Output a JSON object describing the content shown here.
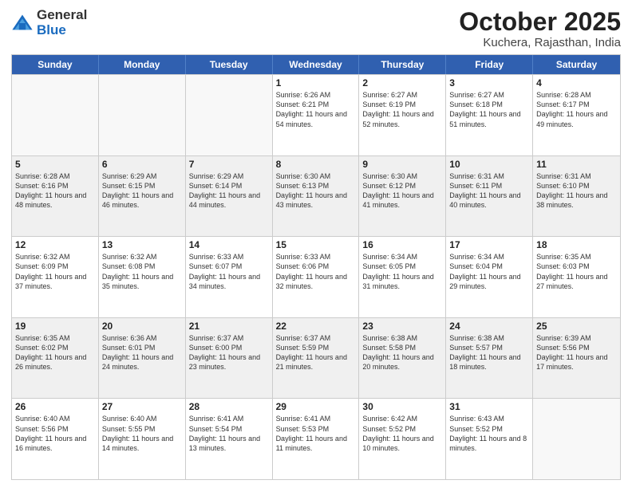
{
  "logo": {
    "general": "General",
    "blue": "Blue"
  },
  "header": {
    "month": "October 2025",
    "location": "Kuchera, Rajasthan, India"
  },
  "days": [
    "Sunday",
    "Monday",
    "Tuesday",
    "Wednesday",
    "Thursday",
    "Friday",
    "Saturday"
  ],
  "rows": [
    [
      {
        "day": "",
        "info": ""
      },
      {
        "day": "",
        "info": ""
      },
      {
        "day": "",
        "info": ""
      },
      {
        "day": "1",
        "info": "Sunrise: 6:26 AM\nSunset: 6:21 PM\nDaylight: 11 hours and 54 minutes."
      },
      {
        "day": "2",
        "info": "Sunrise: 6:27 AM\nSunset: 6:19 PM\nDaylight: 11 hours and 52 minutes."
      },
      {
        "day": "3",
        "info": "Sunrise: 6:27 AM\nSunset: 6:18 PM\nDaylight: 11 hours and 51 minutes."
      },
      {
        "day": "4",
        "info": "Sunrise: 6:28 AM\nSunset: 6:17 PM\nDaylight: 11 hours and 49 minutes."
      }
    ],
    [
      {
        "day": "5",
        "info": "Sunrise: 6:28 AM\nSunset: 6:16 PM\nDaylight: 11 hours and 48 minutes."
      },
      {
        "day": "6",
        "info": "Sunrise: 6:29 AM\nSunset: 6:15 PM\nDaylight: 11 hours and 46 minutes."
      },
      {
        "day": "7",
        "info": "Sunrise: 6:29 AM\nSunset: 6:14 PM\nDaylight: 11 hours and 44 minutes."
      },
      {
        "day": "8",
        "info": "Sunrise: 6:30 AM\nSunset: 6:13 PM\nDaylight: 11 hours and 43 minutes."
      },
      {
        "day": "9",
        "info": "Sunrise: 6:30 AM\nSunset: 6:12 PM\nDaylight: 11 hours and 41 minutes."
      },
      {
        "day": "10",
        "info": "Sunrise: 6:31 AM\nSunset: 6:11 PM\nDaylight: 11 hours and 40 minutes."
      },
      {
        "day": "11",
        "info": "Sunrise: 6:31 AM\nSunset: 6:10 PM\nDaylight: 11 hours and 38 minutes."
      }
    ],
    [
      {
        "day": "12",
        "info": "Sunrise: 6:32 AM\nSunset: 6:09 PM\nDaylight: 11 hours and 37 minutes."
      },
      {
        "day": "13",
        "info": "Sunrise: 6:32 AM\nSunset: 6:08 PM\nDaylight: 11 hours and 35 minutes."
      },
      {
        "day": "14",
        "info": "Sunrise: 6:33 AM\nSunset: 6:07 PM\nDaylight: 11 hours and 34 minutes."
      },
      {
        "day": "15",
        "info": "Sunrise: 6:33 AM\nSunset: 6:06 PM\nDaylight: 11 hours and 32 minutes."
      },
      {
        "day": "16",
        "info": "Sunrise: 6:34 AM\nSunset: 6:05 PM\nDaylight: 11 hours and 31 minutes."
      },
      {
        "day": "17",
        "info": "Sunrise: 6:34 AM\nSunset: 6:04 PM\nDaylight: 11 hours and 29 minutes."
      },
      {
        "day": "18",
        "info": "Sunrise: 6:35 AM\nSunset: 6:03 PM\nDaylight: 11 hours and 27 minutes."
      }
    ],
    [
      {
        "day": "19",
        "info": "Sunrise: 6:35 AM\nSunset: 6:02 PM\nDaylight: 11 hours and 26 minutes."
      },
      {
        "day": "20",
        "info": "Sunrise: 6:36 AM\nSunset: 6:01 PM\nDaylight: 11 hours and 24 minutes."
      },
      {
        "day": "21",
        "info": "Sunrise: 6:37 AM\nSunset: 6:00 PM\nDaylight: 11 hours and 23 minutes."
      },
      {
        "day": "22",
        "info": "Sunrise: 6:37 AM\nSunset: 5:59 PM\nDaylight: 11 hours and 21 minutes."
      },
      {
        "day": "23",
        "info": "Sunrise: 6:38 AM\nSunset: 5:58 PM\nDaylight: 11 hours and 20 minutes."
      },
      {
        "day": "24",
        "info": "Sunrise: 6:38 AM\nSunset: 5:57 PM\nDaylight: 11 hours and 18 minutes."
      },
      {
        "day": "25",
        "info": "Sunrise: 6:39 AM\nSunset: 5:56 PM\nDaylight: 11 hours and 17 minutes."
      }
    ],
    [
      {
        "day": "26",
        "info": "Sunrise: 6:40 AM\nSunset: 5:56 PM\nDaylight: 11 hours and 16 minutes."
      },
      {
        "day": "27",
        "info": "Sunrise: 6:40 AM\nSunset: 5:55 PM\nDaylight: 11 hours and 14 minutes."
      },
      {
        "day": "28",
        "info": "Sunrise: 6:41 AM\nSunset: 5:54 PM\nDaylight: 11 hours and 13 minutes."
      },
      {
        "day": "29",
        "info": "Sunrise: 6:41 AM\nSunset: 5:53 PM\nDaylight: 11 hours and 11 minutes."
      },
      {
        "day": "30",
        "info": "Sunrise: 6:42 AM\nSunset: 5:52 PM\nDaylight: 11 hours and 10 minutes."
      },
      {
        "day": "31",
        "info": "Sunrise: 6:43 AM\nSunset: 5:52 PM\nDaylight: 11 hours and 8 minutes."
      },
      {
        "day": "",
        "info": ""
      }
    ]
  ]
}
